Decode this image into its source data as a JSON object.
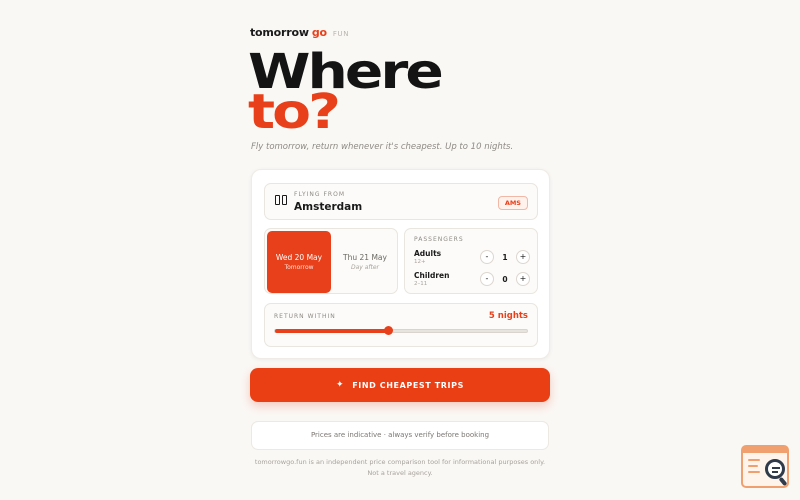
{
  "brand": {
    "part1": "tomorrow",
    "part2": "go",
    "suffix": "FUN"
  },
  "hero": {
    "line1": "Where",
    "line2": "to?"
  },
  "tagline": "Fly tomorrow, return whenever it's cheapest. Up to 10 nights.",
  "flying_from": {
    "label": "FLYING FROM",
    "city": "Amsterdam",
    "code": "AMS"
  },
  "dates": [
    {
      "date": "Wed 20 May",
      "sub": "Tomorrow",
      "selected": true
    },
    {
      "date": "Thu 21 May",
      "sub": "Day after",
      "selected": false
    }
  ],
  "passengers": {
    "label": "PASSENGERS",
    "adults": {
      "name": "Adults",
      "sub": "12+",
      "count": "1"
    },
    "children": {
      "name": "Children",
      "sub": "2–11",
      "count": "0"
    },
    "minus": "-",
    "plus": "+"
  },
  "return_within": {
    "label": "RETURN WITHIN",
    "value": "5 nights",
    "nights": 5,
    "min": 1,
    "max": 10
  },
  "cta": {
    "icon": "sparkle-icon",
    "label": "FIND CHEAPEST TRIPS"
  },
  "note": "Prices are indicative · always verify before booking",
  "disclaimer": {
    "line1": "tomorrowgo.fun is an independent price comparison tool for informational purposes only.",
    "line2": "Not a travel agency."
  },
  "colors": {
    "accent": "#e8401a",
    "background": "#faf8f5"
  }
}
